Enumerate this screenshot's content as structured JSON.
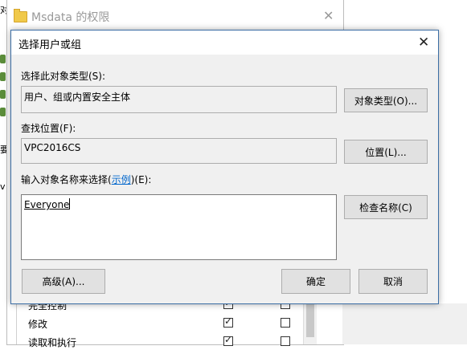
{
  "background_window": {
    "title": "Msdata 的权限",
    "permissions": [
      {
        "label": "完全控制",
        "allow": true,
        "deny": false
      },
      {
        "label": "修改",
        "allow": true,
        "deny": false
      },
      {
        "label": "读取和执行",
        "allow": true,
        "deny": false
      }
    ]
  },
  "left_strip": {
    "chars": [
      "对",
      "要",
      "v"
    ]
  },
  "dialog": {
    "title": "选择用户或组",
    "object_types_label": "选择此对象类型(S):",
    "object_types_value": "用户、组或内置安全主体",
    "object_types_button": "对象类型(O)...",
    "location_label": "查找位置(F):",
    "location_value": "VPC2016CS",
    "location_button": "位置(L)...",
    "names_label_prefix": "输入对象名称来选择(",
    "names_label_link": "示例",
    "names_label_suffix": ")(E):",
    "names_value": "Everyone",
    "check_names_button": "检查名称(C)",
    "advanced_button": "高级(A)...",
    "ok_button": "确定",
    "cancel_button": "取消"
  }
}
